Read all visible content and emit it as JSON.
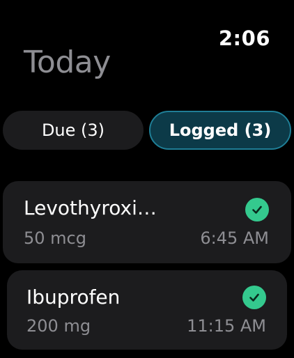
{
  "status": {
    "time": "2:06"
  },
  "page": {
    "title": "Today"
  },
  "tabs": [
    {
      "label": "Due (3)",
      "selected": false
    },
    {
      "label": "Logged (3)",
      "selected": true
    }
  ],
  "logged": [
    {
      "name": "Levothyroxi…",
      "dose": "50 mcg",
      "time": "6:45 AM",
      "status_icon": "checkmark-circle-icon"
    },
    {
      "name": "Ibuprofen",
      "dose": "200 mg",
      "time": "11:15 AM",
      "status_icon": "checkmark-circle-icon"
    }
  ],
  "colors": {
    "background": "#000000",
    "card": "#1c1c1e",
    "secondary_text": "#8e8e93",
    "selected_tab_fill": "#0c3a48",
    "selected_tab_border": "#1f7e96",
    "check": "#34c98e"
  }
}
